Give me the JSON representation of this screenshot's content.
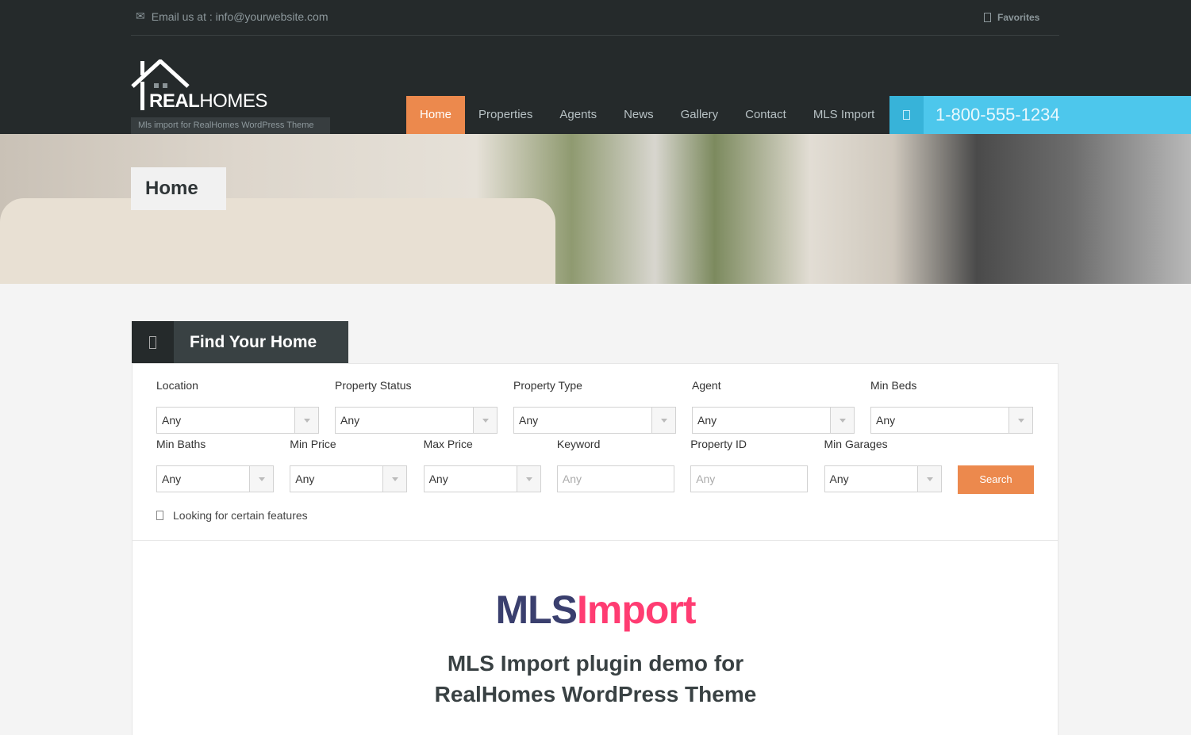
{
  "topbar": {
    "email": "Email us at : info@yourwebsite.com",
    "favorites": "Favorites"
  },
  "logo": {
    "bold": "REAL",
    "light": "HOMES",
    "tagline": "Mls import for RealHomes WordPress Theme"
  },
  "nav": [
    {
      "label": "Home",
      "active": true
    },
    {
      "label": "Properties"
    },
    {
      "label": "Agents"
    },
    {
      "label": "News"
    },
    {
      "label": "Gallery"
    },
    {
      "label": "Contact"
    },
    {
      "label": "MLS Import"
    }
  ],
  "phone": "1-800-555-1234",
  "page_title": "Home",
  "search": {
    "title": "Find Your Home",
    "row1": [
      {
        "label": "Location",
        "value": "Any"
      },
      {
        "label": "Property Status",
        "value": "Any"
      },
      {
        "label": "Property Type",
        "value": "Any"
      },
      {
        "label": "Agent",
        "value": "Any"
      },
      {
        "label": "Min Beds",
        "value": "Any"
      }
    ],
    "row2": [
      {
        "label": "Min Baths",
        "value": "Any",
        "type": "select"
      },
      {
        "label": "Min Price",
        "value": "Any",
        "type": "select"
      },
      {
        "label": "Max Price",
        "value": "Any",
        "type": "select"
      },
      {
        "label": "Keyword",
        "placeholder": "Any",
        "type": "text"
      },
      {
        "label": "Property ID",
        "placeholder": "Any",
        "type": "text"
      },
      {
        "label": "Min Garages",
        "value": "Any",
        "type": "select"
      }
    ],
    "button": "Search",
    "features": "Looking for certain features"
  },
  "content": {
    "brand_a": "MLS",
    "brand_b": "Import",
    "line1": "MLS Import plugin demo for",
    "line2": "RealHomes WordPress Theme"
  },
  "colors": {
    "accent": "#ec894d",
    "phone": "#4dc7ec",
    "brand_a": "#3a3f6e",
    "brand_b": "#ff3c72",
    "header": "#252a2b"
  }
}
